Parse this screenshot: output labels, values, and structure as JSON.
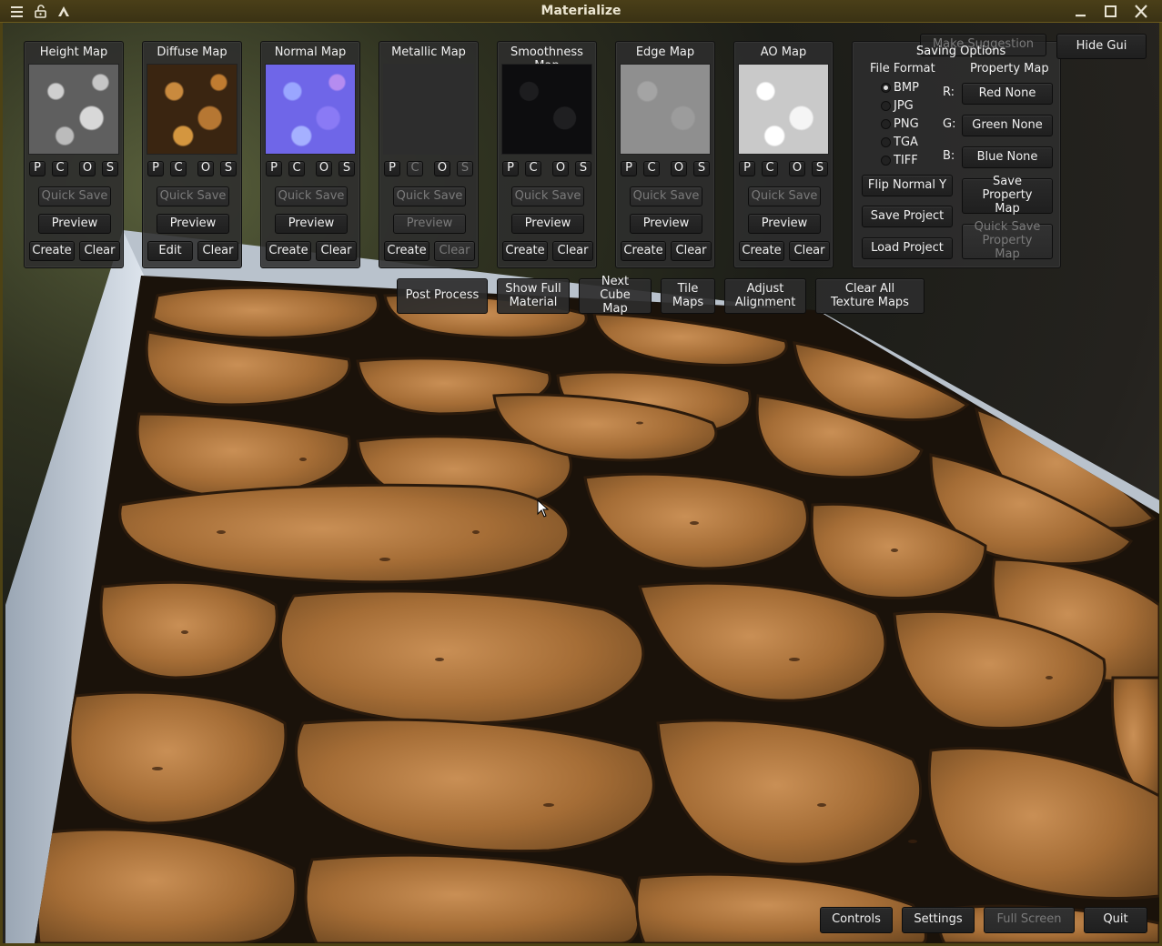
{
  "window": {
    "title": "Materialize"
  },
  "maps": [
    {
      "title": "Height Map",
      "quick_save": "Quick Save",
      "preview": "Preview",
      "left": "Create",
      "right": "Clear",
      "thumb": "height",
      "quick_save_enabled": false,
      "preview_enabled": true,
      "left_enabled": true,
      "right_enabled": true,
      "c_enabled": true,
      "s_enabled": true
    },
    {
      "title": "Diffuse Map",
      "quick_save": "Quick Save",
      "preview": "Preview",
      "left": "Edit",
      "right": "Clear",
      "thumb": "diffuse",
      "quick_save_enabled": false,
      "preview_enabled": true,
      "left_enabled": true,
      "right_enabled": true,
      "c_enabled": true,
      "s_enabled": true
    },
    {
      "title": "Normal Map",
      "quick_save": "Quick Save",
      "preview": "Preview",
      "left": "Create",
      "right": "Clear",
      "thumb": "normal",
      "quick_save_enabled": false,
      "preview_enabled": true,
      "left_enabled": true,
      "right_enabled": true,
      "c_enabled": true,
      "s_enabled": true
    },
    {
      "title": "Metallic Map",
      "quick_save": "Quick Save",
      "preview": "Preview",
      "left": "Create",
      "right": "Clear",
      "thumb": "metallic",
      "quick_save_enabled": false,
      "preview_enabled": false,
      "left_enabled": true,
      "right_enabled": false,
      "c_enabled": false,
      "s_enabled": false
    },
    {
      "title": "Smoothness Map",
      "quick_save": "Quick Save",
      "preview": "Preview",
      "left": "Create",
      "right": "Clear",
      "thumb": "smoothness",
      "quick_save_enabled": false,
      "preview_enabled": true,
      "left_enabled": true,
      "right_enabled": true,
      "c_enabled": true,
      "s_enabled": true
    },
    {
      "title": "Edge Map",
      "quick_save": "Quick Save",
      "preview": "Preview",
      "left": "Create",
      "right": "Clear",
      "thumb": "edge",
      "quick_save_enabled": false,
      "preview_enabled": true,
      "left_enabled": true,
      "right_enabled": true,
      "c_enabled": true,
      "s_enabled": true
    },
    {
      "title": "AO Map",
      "quick_save": "Quick Save",
      "preview": "Preview",
      "left": "Create",
      "right": "Clear",
      "thumb": "ao",
      "quick_save_enabled": false,
      "preview_enabled": true,
      "left_enabled": true,
      "right_enabled": true,
      "c_enabled": true,
      "s_enabled": true
    }
  ],
  "small_buttons": {
    "p": "P",
    "c": "C",
    "o": "O",
    "s": "S"
  },
  "saving": {
    "title": "Saving Options",
    "file_format_label": "File Format",
    "formats": [
      "BMP",
      "JPG",
      "PNG",
      "TGA",
      "TIFF"
    ],
    "selected_format": "BMP",
    "property_map_label": "Property Map",
    "channels": [
      {
        "label": "R:",
        "button": "Red None"
      },
      {
        "label": "G:",
        "button": "Green None"
      },
      {
        "label": "B:",
        "button": "Blue None"
      }
    ],
    "flip_normal_y": "Flip Normal Y",
    "save_project": "Save Project",
    "load_project": "Load Project",
    "save_property_map": "Save Property Map",
    "quick_save_property_map": "Quick Save Property Map"
  },
  "top_right": {
    "make_suggestion": "Make Suggestion",
    "hide_gui": "Hide Gui"
  },
  "toolbar": {
    "post_process": "Post Process",
    "show_full_material": "Show Full Material",
    "next_cube_map": "Next Cube Map",
    "tile_maps": "Tile Maps",
    "adjust_alignment": "Adjust Alignment",
    "clear_all": "Clear All Texture Maps"
  },
  "bottom": {
    "controls": "Controls",
    "settings": "Settings",
    "full_screen": "Full Screen",
    "quit": "Quit"
  }
}
